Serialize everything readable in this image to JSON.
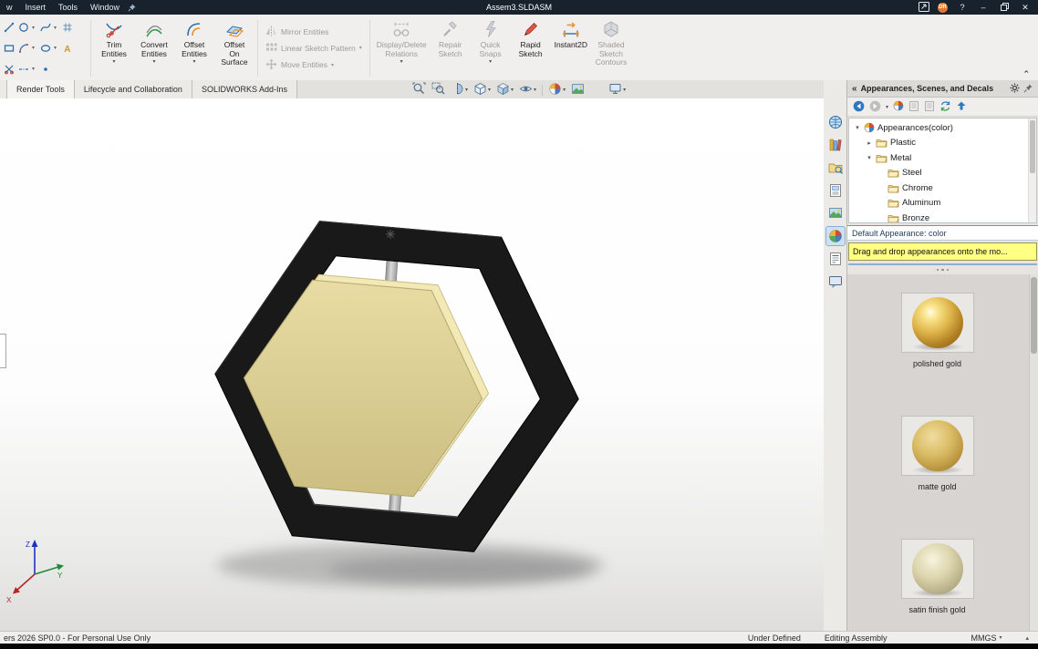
{
  "titlebar": {
    "menu": [
      "w",
      "Insert",
      "Tools",
      "Window"
    ],
    "title": "Assem3.SLDASM",
    "avatar_initials": "DR",
    "help_label": "?"
  },
  "ribbon": {
    "big_buttons": [
      {
        "label": "Trim\nEntities",
        "caret": true,
        "enabled": true
      },
      {
        "label": "Convert\nEntities",
        "caret": true,
        "enabled": true
      },
      {
        "label": "Offset\nEntities",
        "caret": true,
        "enabled": true
      },
      {
        "label": "Offset\nOn\nSurface",
        "caret": false,
        "enabled": true
      },
      {
        "label": "Display/Delete\nRelations",
        "caret": true,
        "enabled": false
      },
      {
        "label": "Repair\nSketch",
        "caret": false,
        "enabled": false
      },
      {
        "label": "Quick\nSnaps",
        "caret": true,
        "enabled": false
      },
      {
        "label": "Rapid\nSketch",
        "caret": false,
        "enabled": true
      },
      {
        "label": "Instant2D",
        "caret": false,
        "enabled": true
      },
      {
        "label": "Shaded\nSketch\nContours",
        "caret": false,
        "enabled": false
      }
    ],
    "row_buttons": [
      {
        "label": "Mirror Entities",
        "caret": false,
        "enabled": false
      },
      {
        "label": "Linear Sketch Pattern",
        "caret": true,
        "enabled": false
      },
      {
        "label": "Move Entities",
        "caret": true,
        "enabled": false
      }
    ]
  },
  "tabs": [
    {
      "label": "Render Tools"
    },
    {
      "label": "Lifecycle and Collaboration"
    },
    {
      "label": "SOLIDWORKS Add-Ins"
    }
  ],
  "taskpane": {
    "title": "Appearances, Scenes, and Decals",
    "tree": [
      {
        "label": "Appearances(color)",
        "icon": "ball",
        "chevron": "expanded",
        "indent": 0
      },
      {
        "label": "Plastic",
        "icon": "folder",
        "chevron": "collapsed",
        "indent": 1
      },
      {
        "label": "Metal",
        "icon": "folder",
        "chevron": "expanded",
        "indent": 1
      },
      {
        "label": "Steel",
        "icon": "folder",
        "chevron": "",
        "indent": 2
      },
      {
        "label": "Chrome",
        "icon": "folder",
        "chevron": "",
        "indent": 2
      },
      {
        "label": "Aluminum",
        "icon": "folder",
        "chevron": "",
        "indent": 2
      },
      {
        "label": "Bronze",
        "icon": "folder",
        "chevron": "",
        "indent": 2
      }
    ],
    "default_appearance": "Default Appearance: color",
    "hint": "Drag and drop appearances onto the mo...",
    "swatches": [
      {
        "label": "polished gold",
        "style": "polished"
      },
      {
        "label": "matte gold",
        "style": "matte"
      },
      {
        "label": "satin finish gold",
        "style": "satin"
      }
    ],
    "side_icons": [
      "resources-icon",
      "design-library-icon",
      "file-explorer-icon",
      "view-palette-icon",
      "scenes-icon",
      "appearances-icon",
      "custom-properties-icon",
      "forum-icon"
    ]
  },
  "headsup_icons": [
    "zoom-to-fit-icon",
    "zoom-to-area-icon",
    "section-view-icon",
    "view-orientation-icon",
    "display-style-icon",
    "hide-show-items-icon",
    "edit-appearance-icon",
    "apply-scene-icon",
    "view-settings-icon"
  ],
  "statusbar": {
    "left": "ers 2026 SP0.0 - For Personal Use Only",
    "constraint_status": "Under Defined",
    "mode": "Editing Assembly",
    "units": "MMGS"
  },
  "colors": {
    "titlebar_bg": "#17222d",
    "hint_yellow": "#ffff84",
    "gold_face": "#d9cc92",
    "frame_black": "#191919",
    "avatar_orange": "#e8762c"
  }
}
